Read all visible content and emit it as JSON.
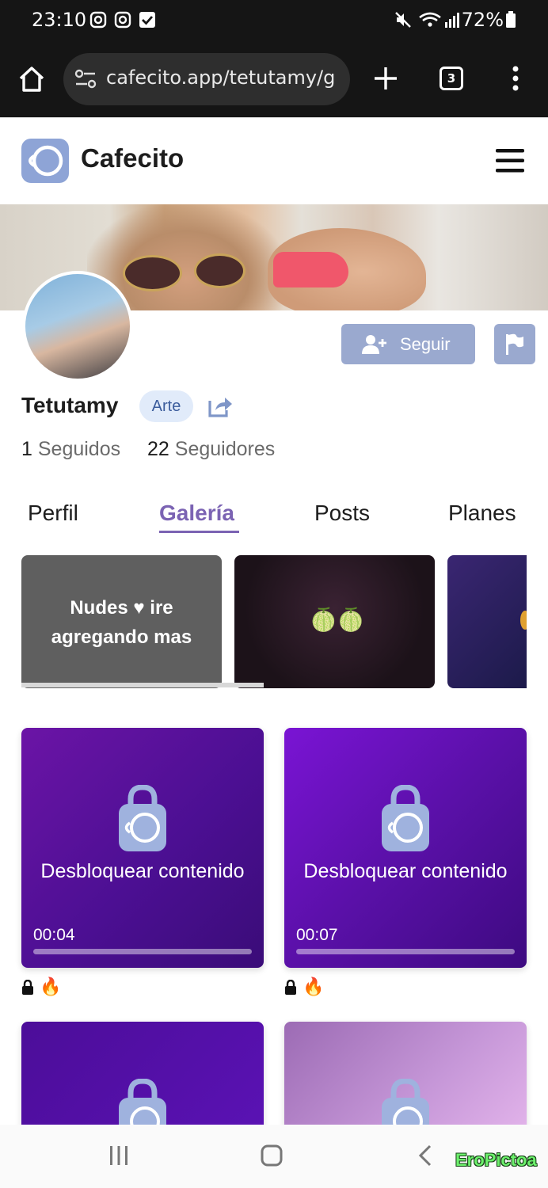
{
  "status_bar": {
    "time": "23:10",
    "battery": "72%",
    "icons": [
      "instagram-icon",
      "instagram-icon",
      "check-icon",
      "mute-icon",
      "wifi-icon",
      "signal-icon",
      "battery-icon"
    ]
  },
  "browser": {
    "url": "cafecito.app/tetutamy/g",
    "tab_count": "3"
  },
  "site": {
    "brand": "Cafecito",
    "accent": "#7b63b3",
    "button_color": "#9aa9cf"
  },
  "profile": {
    "username": "Tetutamy",
    "category": "Arte",
    "follow_label": "Seguir",
    "following_count": "1",
    "following_label": "Seguidos",
    "followers_count": "22",
    "followers_label": "Seguidores"
  },
  "tabs": [
    {
      "label": "Perfil"
    },
    {
      "label": "Galería",
      "active": true
    },
    {
      "label": "Posts"
    },
    {
      "label": "Planes"
    }
  ],
  "carousel": {
    "card1_text": "Nudes ♥ ire agregando mas",
    "card2_emoji": "🍈🍈"
  },
  "gallery": [
    {
      "unlock_label": "Desbloquear contenido",
      "duration": "00:04",
      "meta": "🔥"
    },
    {
      "unlock_label": "Desbloquear contenido",
      "duration": "00:07",
      "meta": "🔥"
    }
  ],
  "watermark": "EroPictoa"
}
